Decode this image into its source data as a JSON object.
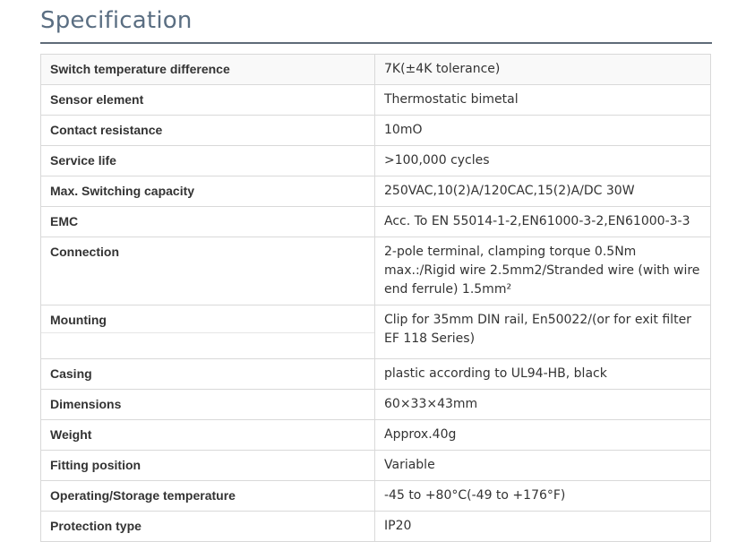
{
  "title": "Specification",
  "rows": [
    {
      "label": "Switch temperature difference",
      "value": "7K(±4K tolerance)"
    },
    {
      "label": "Sensor element",
      "value": "Thermostatic  bimetal"
    },
    {
      "label": "Contact resistance",
      "value": "10mO"
    },
    {
      "label": "Service life",
      "value": ">100,000 cycles"
    },
    {
      "label": "Max. Switching capacity",
      "value": "250VAC,10(2)A/120CAC,15(2)A/DC 30W"
    },
    {
      "label": "EMC",
      "value": "Acc. To EN 55014-1-2,EN61000-3-2,EN61000-3-3"
    },
    {
      "label": "Connection",
      "value": "2-pole terminal, clamping torque 0.5Nm max.:/Rigid wire 2.5mm2/Stranded wire (with wire end ferrule) 1.5mm²"
    },
    {
      "label": "Mounting",
      "value": "Clip for 35mm DIN rail, En50022/(or for exit filter EF 118 Series)"
    },
    {
      "label": "Casing",
      "value": "plastic according to UL94-HB, black"
    },
    {
      "label": "Dimensions",
      "value": "60×33×43mm"
    },
    {
      "label": "Weight",
      "value": "Approx.40g"
    },
    {
      "label": "Fitting position",
      "value": "Variable"
    },
    {
      "label": "Operating/Storage temperature",
      "value": "-45 to +80°C(-49 to +176°F)"
    },
    {
      "label": "Protection type",
      "value": "IP20"
    }
  ]
}
